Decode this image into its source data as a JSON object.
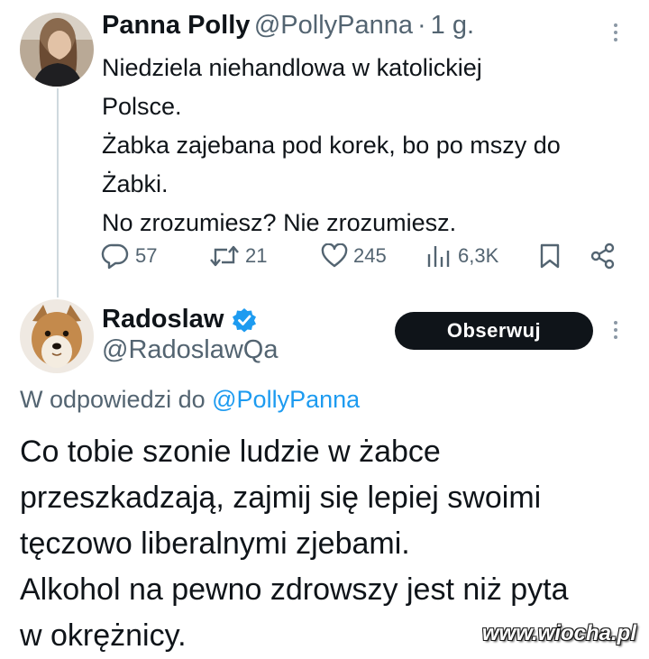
{
  "tweet1": {
    "display_name": "Panna Polly",
    "handle": "@PollyPanna",
    "separator": "·",
    "time": "1 g.",
    "lines": [
      "Niedziela niehandlowa w katolickiej",
      "Polsce.",
      "Żabka zajebana pod korek, bo po mszy do",
      "Żabki.",
      "No zrozumiesz? Nie zrozumiesz."
    ],
    "stats": {
      "replies": "57",
      "reposts": "21",
      "likes": "245",
      "views": "6,3K"
    },
    "icons": {
      "reply": "reply-icon",
      "repost": "repost-icon",
      "like": "heart-icon",
      "views": "views-icon",
      "bookmark": "bookmark-icon",
      "share": "share-icon",
      "more": "more-icon"
    }
  },
  "tweet2": {
    "display_name": "Radoslaw",
    "handle": "@RadoslawQa",
    "verified_color": "#1d9bf0",
    "follow_label": "Obserwuj",
    "reply_prefix": "W odpowiedzi do",
    "reply_mention": "@PollyPanna",
    "lines": [
      "Co tobie szonie ludzie w żabce",
      "przeszkadzają, zajmij się lepiej swoimi",
      "tęczowo liberalnymi zjebami.",
      "Alkohol na pewno zdrowszy jest niż pyta",
      "w okrężnicy."
    ]
  },
  "watermark": "www.wiocha.pl",
  "colors": {
    "text": "#0f1419",
    "secondary": "#536471",
    "link": "#1d9bf0",
    "button_bg": "#0f1419"
  }
}
